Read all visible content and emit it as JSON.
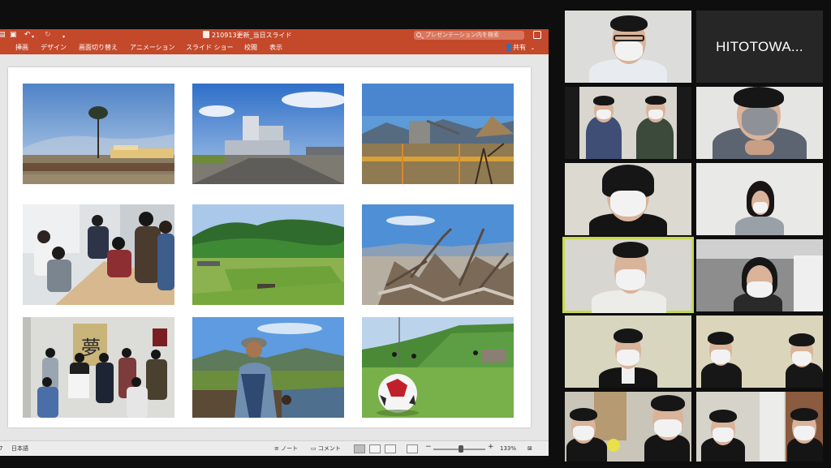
{
  "powerpoint": {
    "title_bar": {
      "document_title": "210913更新_当日スライド",
      "search_placeholder": "プレゼンテーション内を検索"
    },
    "ribbon_tabs": [
      "挿画",
      "デザイン",
      "画面切り替え",
      "アニメーション",
      "スライド ショー",
      "校閲",
      "表示"
    ],
    "share_label": "共有",
    "slide": {
      "photos": [
        {
          "subject": "lone tree on tsunami-cleared coast"
        },
        {
          "subject": "industrial plant building under blue sky"
        },
        {
          "subject": "construction site with mountains"
        },
        {
          "subject": "meeting of people around a table"
        },
        {
          "subject": "green sports field in valley"
        },
        {
          "subject": "driftwood debris pile"
        },
        {
          "subject": "group photo under 夢 calligraphy"
        },
        {
          "subject": "man in bucket hat holding soil by a pond"
        },
        {
          "subject": "soccer ball on grassy field"
        }
      ]
    },
    "status_bar": {
      "slide_number_fragment": "7",
      "language": "日本語",
      "notes_label": "ノート",
      "comments_label": "コメント",
      "zoom_percent": "133%"
    }
  },
  "zoom": {
    "participants": [
      {
        "label": ""
      },
      {
        "label": "HITOTOWA..."
      },
      {
        "label": ""
      },
      {
        "label": ""
      },
      {
        "label": ""
      },
      {
        "label": ""
      },
      {
        "label": "",
        "active_speaker": true
      },
      {
        "label": ""
      },
      {
        "label": ""
      },
      {
        "label": ""
      },
      {
        "label": ""
      },
      {
        "label": ""
      }
    ]
  },
  "colors": {
    "powerpoint_accent": "#c4482a",
    "active_speaker_border": "#c6d94e",
    "zoom_background": "#0e0e0e"
  }
}
